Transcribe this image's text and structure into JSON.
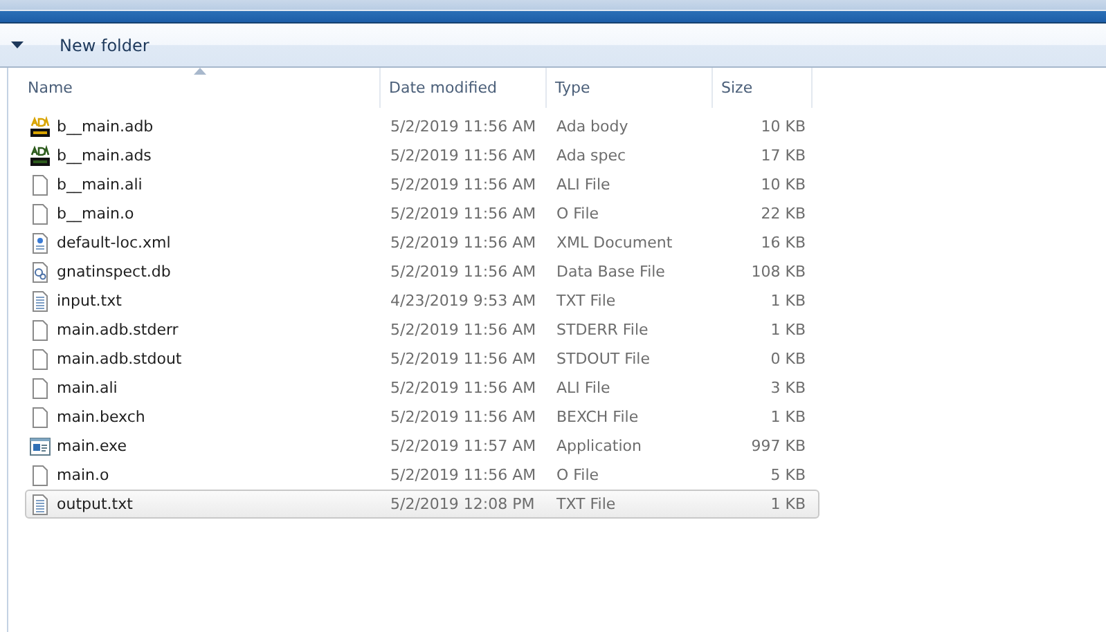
{
  "toolbar": {
    "new_folder": "New folder"
  },
  "table": {
    "columns": [
      {
        "label": "Name",
        "sorted": true
      },
      {
        "label": "Date modified",
        "sorted": false
      },
      {
        "label": "Type",
        "sorted": false
      },
      {
        "label": "Size",
        "sorted": false
      }
    ],
    "rows": [
      {
        "kind": "ada-body",
        "name": "b__main.adb",
        "date": "5/2/2019 11:56 AM",
        "type": "Ada body",
        "size": "10 KB",
        "selected": false
      },
      {
        "kind": "ada-spec",
        "name": "b__main.ads",
        "date": "5/2/2019 11:56 AM",
        "type": "Ada spec",
        "size": "17 KB",
        "selected": false
      },
      {
        "kind": "blank",
        "name": "b__main.ali",
        "date": "5/2/2019 11:56 AM",
        "type": "ALI File",
        "size": "10 KB",
        "selected": false
      },
      {
        "kind": "blank",
        "name": "b__main.o",
        "date": "5/2/2019 11:56 AM",
        "type": "O File",
        "size": "22 KB",
        "selected": false
      },
      {
        "kind": "xml",
        "name": "default-loc.xml",
        "date": "5/2/2019 11:56 AM",
        "type": "XML Document",
        "size": "16 KB",
        "selected": false
      },
      {
        "kind": "db",
        "name": "gnatinspect.db",
        "date": "5/2/2019 11:56 AM",
        "type": "Data Base File",
        "size": "108 KB",
        "selected": false
      },
      {
        "kind": "text",
        "name": "input.txt",
        "date": "4/23/2019 9:53 AM",
        "type": "TXT File",
        "size": "1 KB",
        "selected": false
      },
      {
        "kind": "blank",
        "name": "main.adb.stderr",
        "date": "5/2/2019 11:56 AM",
        "type": "STDERR File",
        "size": "1 KB",
        "selected": false
      },
      {
        "kind": "blank",
        "name": "main.adb.stdout",
        "date": "5/2/2019 11:56 AM",
        "type": "STDOUT File",
        "size": "0 KB",
        "selected": false
      },
      {
        "kind": "blank",
        "name": "main.ali",
        "date": "5/2/2019 11:56 AM",
        "type": "ALI File",
        "size": "3 KB",
        "selected": false
      },
      {
        "kind": "blank",
        "name": "main.bexch",
        "date": "5/2/2019 11:56 AM",
        "type": "BEXCH File",
        "size": "1 KB",
        "selected": false
      },
      {
        "kind": "exe",
        "name": "main.exe",
        "date": "5/2/2019 11:57 AM",
        "type": "Application",
        "size": "997 KB",
        "selected": false
      },
      {
        "kind": "blank",
        "name": "main.o",
        "date": "5/2/2019 11:56 AM",
        "type": "O File",
        "size": "5 KB",
        "selected": false
      },
      {
        "kind": "text",
        "name": "output.txt",
        "date": "5/2/2019 12:08 PM",
        "type": "TXT File",
        "size": "1 KB",
        "selected": true
      }
    ]
  }
}
